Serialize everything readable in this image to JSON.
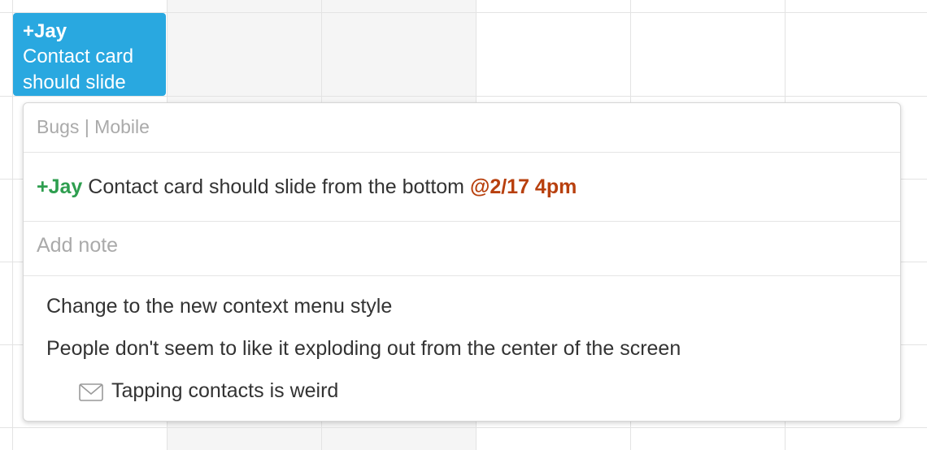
{
  "event_chip": {
    "assignee": "+Jay",
    "title_line1": "Contact card",
    "title_line2": "should slide",
    "color": "#29a8e0"
  },
  "popover": {
    "category": "Bugs | Mobile",
    "task": {
      "assignee": "+Jay",
      "text": "Contact card should slide from the bottom",
      "due": "@2/17 4pm",
      "assignee_color": "#2e9e4f",
      "due_color": "#b8400e"
    },
    "note": {
      "placeholder": "Add note",
      "value": ""
    },
    "comments": [
      {
        "text": "Change to the new context menu style"
      },
      {
        "text": "People don't seem to like it exploding out from the center of the screen"
      },
      {
        "text": "Tapping contacts is weird",
        "icon": "mail-icon"
      }
    ]
  }
}
